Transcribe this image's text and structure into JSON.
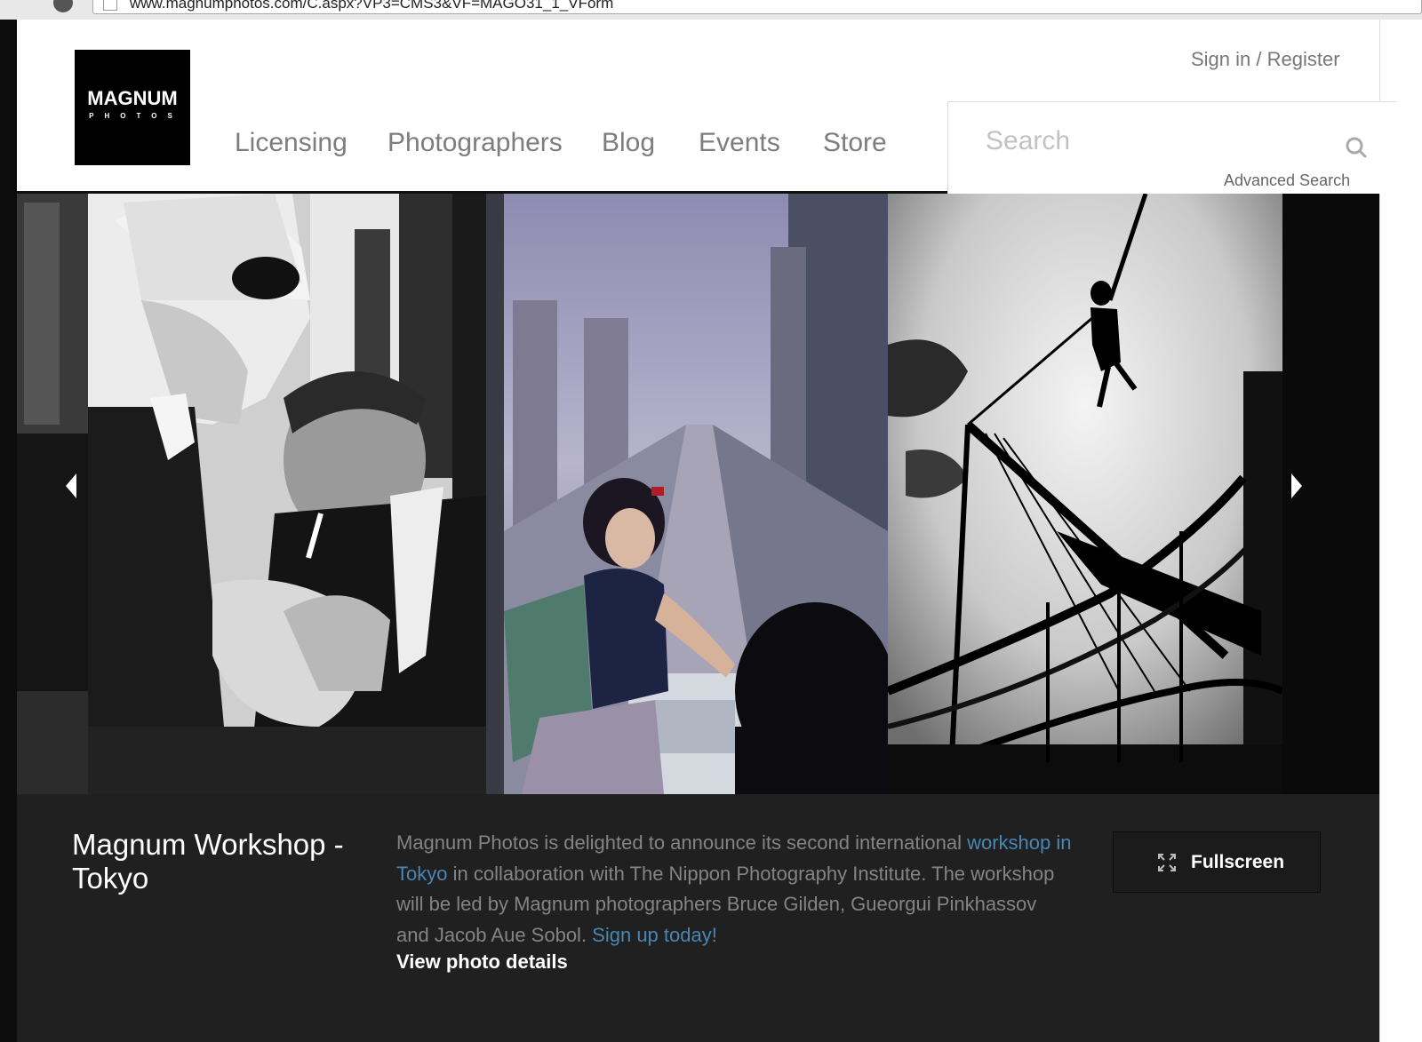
{
  "browser": {
    "url": "www.magnumphotos.com/C.aspx?VP3=CMS3&VF=MAGO31_1_VForm"
  },
  "logo": {
    "line1": "MAGNUM",
    "line2": "PHOTOS"
  },
  "header": {
    "signin": "Sign in / Register",
    "nav": [
      "Licensing",
      "Photographers",
      "Blog",
      "Events",
      "Store"
    ]
  },
  "search": {
    "placeholder": "Search",
    "advanced": "Advanced Search"
  },
  "carousel": {
    "photos": [
      {
        "subject": "two men in suits lighting a cigarette, black and white"
      },
      {
        "subject": "girl at a train window overlooking a track, colour"
      },
      {
        "subject": "child on a swing rope above a roller coaster, black and white"
      }
    ]
  },
  "caption": {
    "title": "Magnum Workshop - Tokyo",
    "desc_1": "Magnum Photos is delighted to announce its second international ",
    "desc_link1": "workshop in Tokyo",
    "desc_2": " in collaboration with The Nippon Photography Institute. The workshop will be led by Magnum photographers Bruce Gilden, Gueorgui Pinkhassov and Jacob Aue Sobol. ",
    "desc_link2": "Sign up today!",
    "view_details": "View photo details",
    "fullscreen": "Fullscreen"
  },
  "colors": {
    "link": "#4a86b4",
    "caption_bg": "#202020",
    "nav_text": "#7d7d7d"
  }
}
